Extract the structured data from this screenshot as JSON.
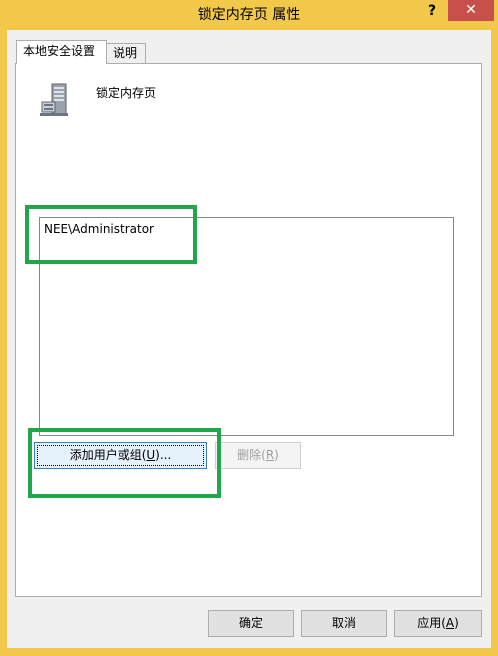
{
  "window": {
    "title": "锁定内存页 属性",
    "help_label": "?",
    "close_label": "✕"
  },
  "tabs": [
    {
      "label": "本地安全设置",
      "active": true
    },
    {
      "label": "说明",
      "active": false
    }
  ],
  "policy": {
    "icon": "server-icon",
    "name": "锁定内存页"
  },
  "users": [
    "NEE\\Administrator"
  ],
  "buttons": {
    "add_prefix": "添加用户或组(",
    "add_mnemonic": "U",
    "add_suffix": ")...",
    "remove_prefix": "删除(",
    "remove_mnemonic": "R",
    "remove_suffix": ")",
    "ok": "确定",
    "cancel": "取消",
    "apply_prefix": "应用(",
    "apply_mnemonic": "A",
    "apply_suffix": ")"
  },
  "colors": {
    "frame": "#f2c84b",
    "close_button": "#c7504a",
    "highlight": "#22a64a"
  }
}
